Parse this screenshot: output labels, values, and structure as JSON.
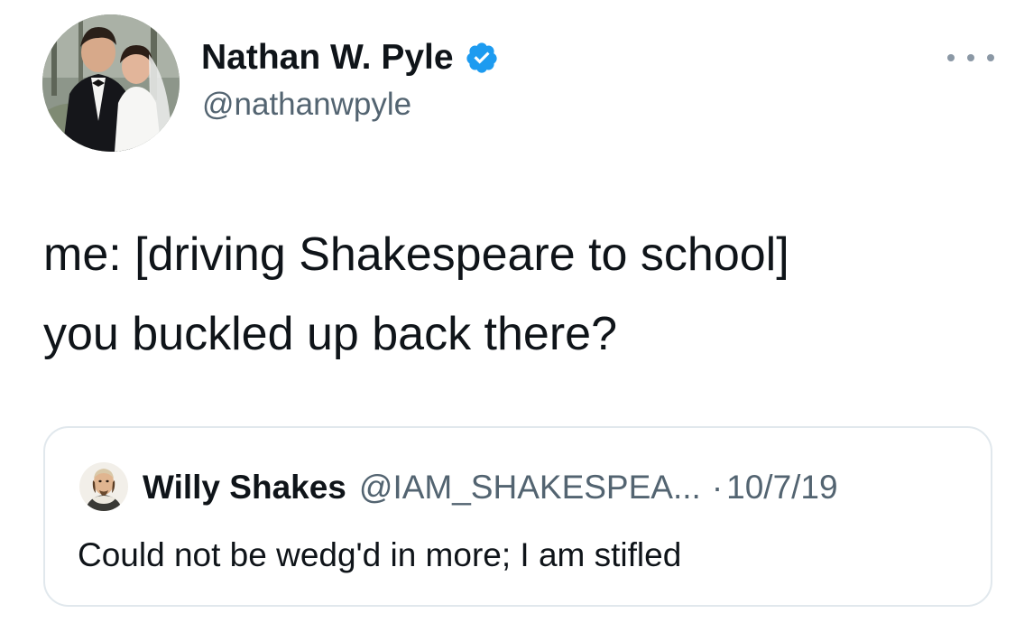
{
  "tweet": {
    "author": {
      "display_name": "Nathan W. Pyle",
      "handle": "@nathanwpyle",
      "verified": true,
      "avatar_icon": "wedding-photo-avatar"
    },
    "more_icon": "ellipsis-icon",
    "text_lines": [
      "me: [driving Shakespeare to school]",
      "you buckled up back there?"
    ]
  },
  "quoted_tweet": {
    "author": {
      "display_name": "Willy Shakes",
      "handle": "@IAM_SHAKESPEA...",
      "avatar_icon": "shakespeare-portrait-avatar"
    },
    "separator": "·",
    "date": "10/7/19",
    "text": "Could not be wedg'd in more; I am stifled"
  },
  "colors": {
    "verified_badge": "#1d9bf0",
    "secondary_text": "#536471",
    "card_border": "#e1e8ed"
  }
}
